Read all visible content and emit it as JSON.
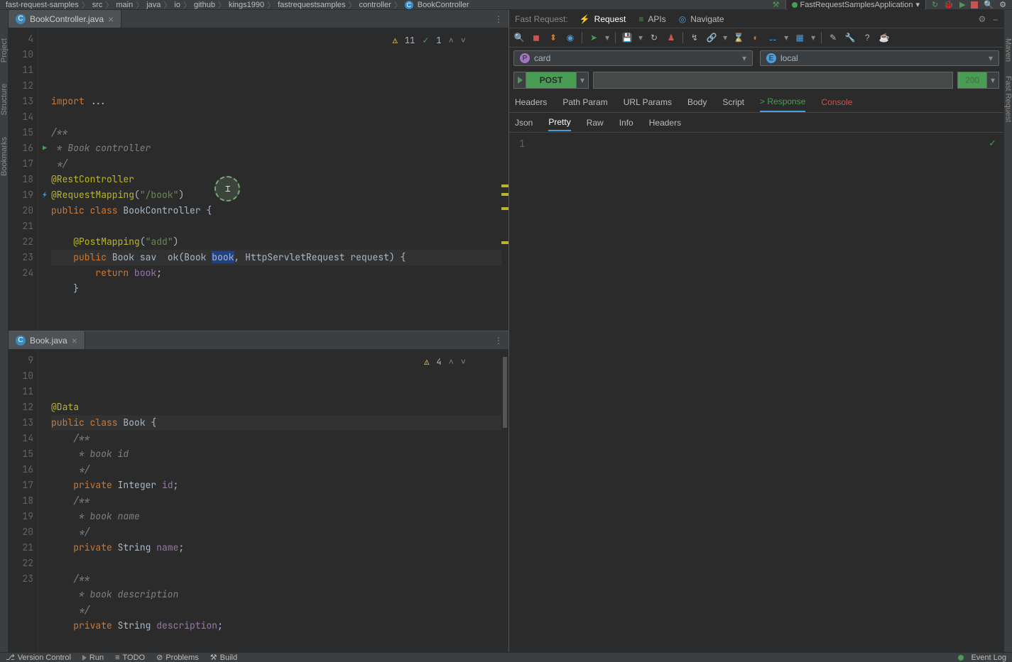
{
  "breadcrumb": [
    "fast-request-samples",
    "src",
    "main",
    "java",
    "io",
    "github",
    "kings1990",
    "fastrequestsamples",
    "controller",
    "BookController"
  ],
  "run_config": "FastRequestSamplesApplication",
  "editor1": {
    "tab_label": "BookController.java",
    "warn_count": "11",
    "check_count": "1",
    "lines": [
      {
        "n": "4",
        "html": "<span class='kw'>import</span> ..."
      },
      {
        "n": "10",
        "html": ""
      },
      {
        "n": "11",
        "html": "<span class='cmt'>/**</span>"
      },
      {
        "n": "12",
        "html": "<span class='cmt'> * Book controller</span>"
      },
      {
        "n": "13",
        "html": "<span class='cmt'> */</span>"
      },
      {
        "n": "14",
        "html": "<span class='ann'>@RestController</span>"
      },
      {
        "n": "15",
        "html": "<span class='ann'>@RequestMapping</span>(<span class='str'>\"/book\"</span>)"
      },
      {
        "n": "16",
        "html": "<span class='kw'>public class</span> <span class='cls'>BookController</span> {"
      },
      {
        "n": "17",
        "html": ""
      },
      {
        "n": "18",
        "html": "    <span class='ann'>@PostMapping</span>(<span class='str'>\"add\"</span>)"
      },
      {
        "n": "19",
        "html": "    <span class='kw'>public</span> <span class='cls'>Book</span> <span class='param'>sav</span>  <span class='param'>ok</span>(<span class='cls'>Book</span> <span class='sel-word'>book</span>, <span class='cls'>HttpServletRequest</span> <span class='param'>request</span>) {",
        "hl": true
      },
      {
        "n": "20",
        "html": "        <span class='kw'>return</span> <span class='ident'>book</span>;"
      },
      {
        "n": "21",
        "html": "    }"
      },
      {
        "n": "22",
        "html": ""
      },
      {
        "n": "23",
        "html": ""
      },
      {
        "n": "24",
        "html": ""
      }
    ]
  },
  "editor2": {
    "tab_label": "Book.java",
    "warn_count": "4",
    "lines": [
      {
        "n": "9",
        "html": "<span class='ann'>@Data</span>"
      },
      {
        "n": "10",
        "html": "<span class='kw'>public class</span> <span class='cls'>Book</span> {",
        "hl": true
      },
      {
        "n": "11",
        "html": "    <span class='cmt'>/**</span>"
      },
      {
        "n": "12",
        "html": "    <span class='cmt'> * book id</span>"
      },
      {
        "n": "13",
        "html": "    <span class='cmt'> */</span>"
      },
      {
        "n": "14",
        "html": "    <span class='kw'>private</span> <span class='cls'>Integer</span> <span class='ident'>id</span>;"
      },
      {
        "n": "15",
        "html": "    <span class='cmt'>/**</span>"
      },
      {
        "n": "16",
        "html": "    <span class='cmt'> * book name</span>"
      },
      {
        "n": "17",
        "html": "    <span class='cmt'> */</span>"
      },
      {
        "n": "18",
        "html": "    <span class='kw'>private</span> <span class='cls'>String</span> <span class='ident'>name</span>;"
      },
      {
        "n": "19",
        "html": ""
      },
      {
        "n": "20",
        "html": "    <span class='cmt'>/**</span>"
      },
      {
        "n": "21",
        "html": "    <span class='cmt'> * book description</span>"
      },
      {
        "n": "22",
        "html": "    <span class='cmt'> */</span>"
      },
      {
        "n": "23",
        "html": "    <span class='kw'>private</span> <span class='cls'>String</span> <span class='ident'>description</span>;"
      }
    ]
  },
  "plugin": {
    "title": "Fast Request:",
    "top_tabs": {
      "request": "Request",
      "apis": "APIs",
      "navigate": "Navigate"
    },
    "project_select": "card",
    "env_select": "local",
    "method": "POST",
    "url": "",
    "status": "200",
    "req_tabs": [
      "Headers",
      "Path Param",
      "URL Params",
      "Body",
      "Script",
      "> Response",
      "Console"
    ],
    "resp_subtabs": [
      "Json",
      "Pretty",
      "Raw",
      "Info",
      "Headers"
    ]
  },
  "left_gutter_tabs": [
    "Bookmarks",
    "Structure",
    "Project"
  ],
  "right_gutter_tabs": [
    "Maven",
    "Fast Request"
  ],
  "bottom_bar": {
    "version_control": "Version Control",
    "run": "Run",
    "todo": "TODO",
    "problems": "Problems",
    "build": "Build",
    "event_log": "Event Log"
  }
}
